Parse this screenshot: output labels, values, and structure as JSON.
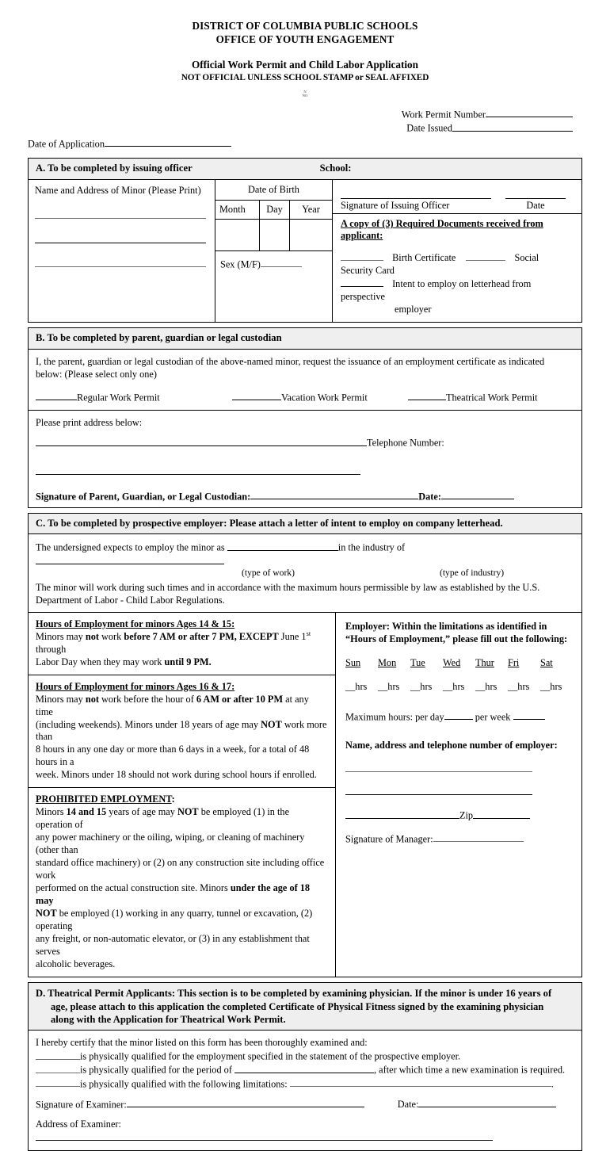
{
  "header": {
    "line1": "DISTRICT OF COLUMBIA PUBLIC SCHOOLS",
    "line2": "OFFICE OF YOUTH ENGAGEMENT",
    "line3": "Official Work Permit and Child Labor Application",
    "line4": "NOT OFFICIAL UNLESS SCHOOL STAMP or SEAL AFFIXED",
    "tiny1": "N",
    "tiny2": "NO"
  },
  "permit": {
    "work_permit_number_label": "Work Permit Number",
    "date_issued_label": "Date Issued",
    "date_of_application_label": "Date of Application"
  },
  "sectionA": {
    "band": "A. To be completed by issuing officer",
    "school_label": "School:",
    "minor_name_label": "Name and Address of Minor (Please Print)",
    "dob_title": "Date of Birth",
    "dob_month": "Month",
    "dob_day": "Day",
    "dob_year": "Year",
    "sex_label": "Sex (M/F)",
    "signature_officer_label": "Signature of Issuing Officer",
    "date_label": "Date",
    "documents_title": "A copy of (3) Required Documents received from applicant:",
    "doc1": "Birth Certificate",
    "doc2": "Social Security Card",
    "doc3_line1": "Intent to employ on letterhead from perspective",
    "doc3_line2": "employer"
  },
  "sectionB": {
    "band": "B.   To be completed by parent, guardian or legal custodian",
    "intro_line1": "I, the parent, guardian or legal custodian of the above-named minor, request the issuance of an employment certificate as indicated",
    "intro_line2": "below: (Please select only one)",
    "option1": "Regular Work Permit",
    "option2": "Vacation Work Permit",
    "option3": "Theatrical Work Permit",
    "address_label": "Please print address below:",
    "telephone_label": "Telephone Number:",
    "signature_label": "Signature of Parent, Guardian, or Legal Custodian:",
    "date_label": "Date:"
  },
  "sectionC": {
    "band": "C. To be completed by prospective employer: Please attach a letter of intent to employ on company letterhead.",
    "line1_a": "The undersigned expects to employ the minor as",
    "line1_b": "in the industry of",
    "sub1": "(type of work)",
    "sub2": "(type of industry)",
    "para_line1": "The minor will work during such times and in accordance with the maximum hours permissible by law as established by the U.S.",
    "para_line2": "Department of Labor - Child Labor Regulations.",
    "hours_14_15": {
      "title": "Hours of Employment for minors Ages 14 & 15:",
      "body_pre": "Minors may ",
      "b1": "not",
      "body_mid1": " work ",
      "b2": "before 7 AM or after 7 PM, EXCEPT",
      "body_mid2": " June 1",
      "sup": "st",
      "body_mid3": " through",
      "body_line2_pre": "Labor Day when they may work ",
      "b3": "until 9 PM."
    },
    "hours_16_17": {
      "title": "Hours of Employment for minors Ages 16 & 17:",
      "t1": "Minors may ",
      "b1": "not",
      "t2": " work before the hour of ",
      "b2": "6 AM or after 10 PM",
      "t3": " at any time",
      "t4": "(including weekends). Minors under 18 years of age may ",
      "b3": "NOT",
      "t5": " work more than",
      "t6": "8 hours in any one day or more than 6 days in a week, for a total of 48 hours in a",
      "t7": "week. Minors under 18 should not work during school hours if enrolled."
    },
    "prohibited": {
      "title": "PROHIBITED EMPLOYMENT",
      "title_colon": ":",
      "t1": "Minors ",
      "b1": "14 and 15",
      "t2": " years of age may ",
      "b2": "NOT",
      "t3": " be employed (1) in the operation of",
      "t4": "any power machinery or the oiling, wiping, or cleaning of machinery (other than",
      "t5": "standard office machinery) or (2) on any construction site including office work",
      "t6": "performed on the actual construction site. Minors ",
      "b3": "under the age of 18 may",
      "b4": "NOT",
      "t7": " be employed (1) working in any quarry, tunnel or excavation, (2) operating",
      "t8": "any freight, or non-automatic elevator, or (3) in any establishment that serves",
      "t9": "alcoholic beverages."
    },
    "employer": {
      "head_line1": "Employer: Within the limitations as identified in",
      "head_line2": "“Hours of Employment,” please fill out the following:",
      "days": [
        "Sun",
        "Mon",
        "Tue",
        "Wed",
        "Thur",
        "Fri",
        "Sat"
      ],
      "hrs_cells": [
        "__hrs",
        "__hrs",
        "__hrs",
        "__hrs",
        "__hrs",
        "__hrs",
        "__hrs"
      ],
      "max_hours_label": "Maximum hours:  per day",
      "per_week_label": " per week ",
      "name_addr_label": "Name, address and telephone number of employer:",
      "zip_label": "Zip",
      "signature_manager_label": "Signature of Manager:"
    }
  },
  "sectionD": {
    "band_line1": "D.  Theatrical Permit Applicants: This section is to be completed by examining physician. If the minor is under 16 years of",
    "band_line2": "age, please attach to this application the completed Certificate of Physical Fitness signed by the examining physician",
    "band_line3": "along with the Application for Theatrical Work Permit.",
    "certify": "I hereby certify that the minor listed on this form has been thoroughly examined and:",
    "q1": "is physically qualified for the employment specified in the statement of the prospective employer.",
    "q2_a": "is physically qualified for the period of",
    "q2_b": ", after which time a new examination is required.",
    "q3": "is physically qualified with the following limitations:",
    "q3_end": ".",
    "signature_examiner_label": "Signature of Examiner:",
    "date_label": "Date:",
    "address_examiner_label": "Address of Examiner:"
  },
  "colors": {
    "band_fill": "#efefef",
    "rule": "#000000",
    "light_rule": "#6f6f6f"
  }
}
